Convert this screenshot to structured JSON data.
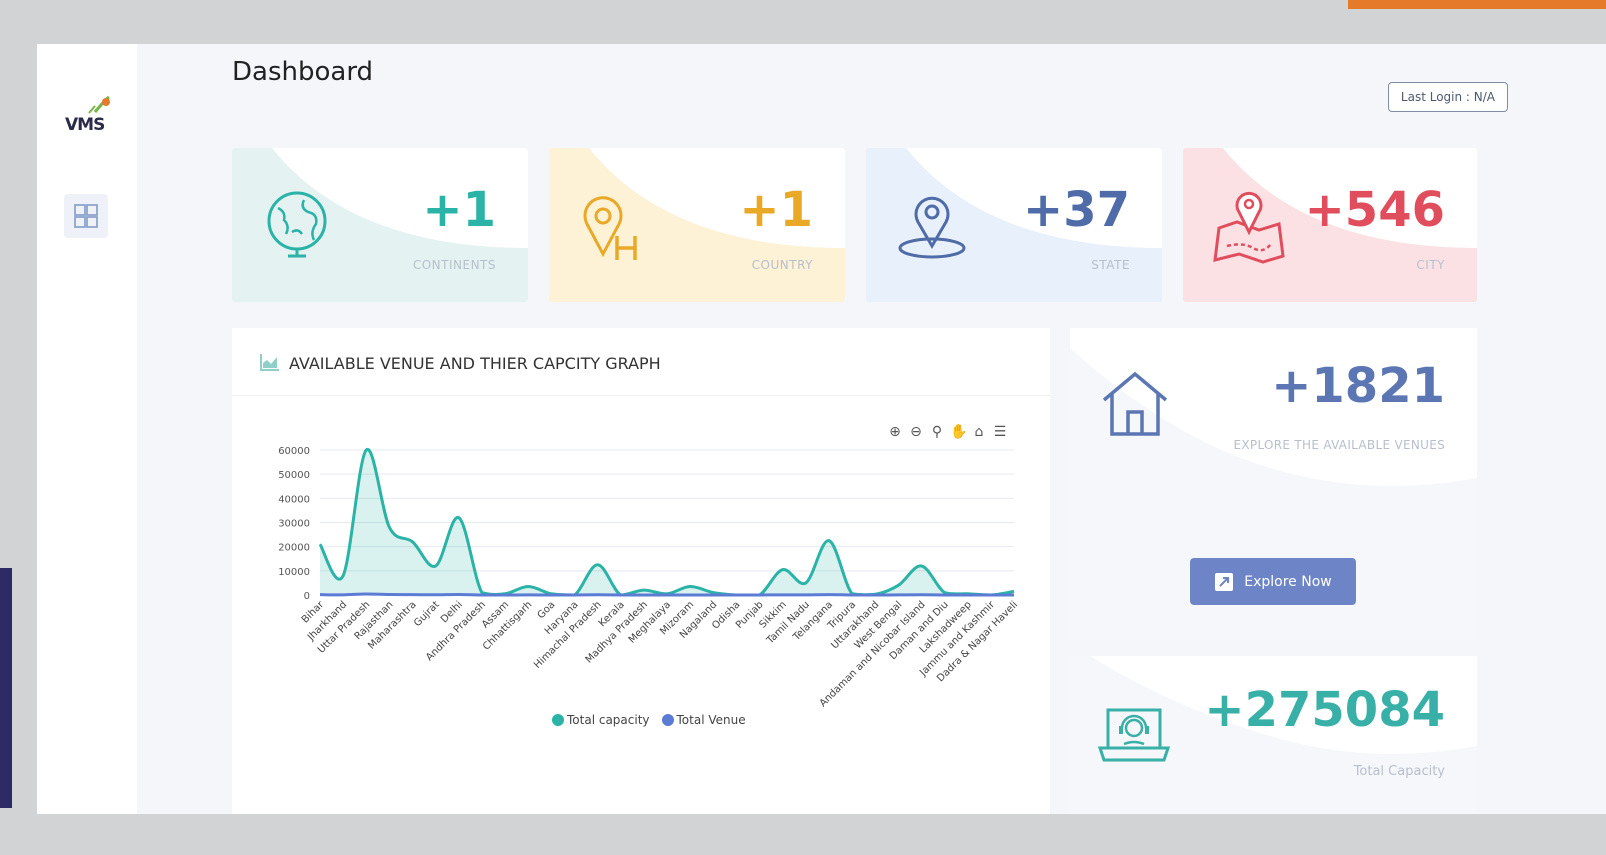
{
  "app": {
    "logo_text": "VMS"
  },
  "page": {
    "title": "Dashboard",
    "last_login": "Last Login : N/A"
  },
  "stats": [
    {
      "value": "+1",
      "label": "CONTINENTS",
      "icon": "globe-icon",
      "color": "#2ab3a6",
      "bg": "#e4f3f2"
    },
    {
      "value": "+1",
      "label": "COUNTRY",
      "icon": "country-pin-icon",
      "color": "#e9a927",
      "bg": "#fdf1d6"
    },
    {
      "value": "+37",
      "label": "STATE",
      "icon": "location-pin-icon",
      "color": "#4f6ba8",
      "bg": "#e8f0fb"
    },
    {
      "value": "+546",
      "label": "CITY",
      "icon": "map-route-icon",
      "color": "#e04e5e",
      "bg": "#fbe1e3"
    }
  ],
  "chart_card": {
    "title": "AVAILABLE VENUE AND THIER CAPCITY GRAPH"
  },
  "venues": {
    "value": "+1821",
    "label": "EXPLORE THE AVAILABLE VENUES",
    "button": "Explore Now",
    "icon": "house-icon"
  },
  "capacity": {
    "value": "+275084",
    "label": "Total Capacity",
    "icon": "support-laptop-icon"
  },
  "toolbar": [
    "zoom-in-icon",
    "zoom-out-icon",
    "magnify-icon",
    "pan-hand-icon",
    "home-icon",
    "menu-icon"
  ],
  "chart_data": {
    "type": "area",
    "title": "",
    "categories": [
      "Bihar",
      "Jharkhand",
      "Uttar Pradesh",
      "Rajasthan",
      "Maharashtra",
      "Gujrat",
      "Delhi",
      "Andhra Pradesh",
      "Assam",
      "Chhattisgarh",
      "Goa",
      "Haryana",
      "Himachal Pradesh",
      "Kerala",
      "Madhya Pradesh",
      "Meghalaya",
      "Mizoram",
      "Nagaland",
      "Odisha",
      "Punjab",
      "Sikkim",
      "Tamil Nadu",
      "Telangana",
      "Tripura",
      "Uttarakhand",
      "West Bengal",
      "Andaman and Nicobar Island",
      "Daman and Diu",
      "Lakshadweep",
      "Jammu and Kashmir",
      "Dadra & Nagar Haveli"
    ],
    "series": [
      {
        "name": "Total capacity",
        "color": "#2ab3a6",
        "values": [
          21000,
          8000,
          60000,
          28000,
          22000,
          12000,
          32000,
          1000,
          500,
          3500,
          500,
          0,
          12500,
          0,
          2000,
          500,
          3500,
          1000,
          0,
          0,
          10500,
          5000,
          22500,
          500,
          300,
          4000,
          12000,
          1000,
          500,
          0,
          1500
        ]
      },
      {
        "name": "Total Venue",
        "color": "#5b7bd5",
        "values": [
          150,
          60,
          420,
          200,
          150,
          90,
          220,
          10,
          5,
          30,
          5,
          0,
          90,
          0,
          15,
          5,
          25,
          10,
          0,
          0,
          75,
          35,
          160,
          5,
          3,
          30,
          85,
          10,
          5,
          0,
          12
        ]
      }
    ],
    "ylim": [
      0,
      60000
    ],
    "yticks": [
      "60000",
      "50000",
      "40000",
      "30000",
      "20000",
      "10000",
      "0"
    ],
    "grid": true,
    "legend": "bottom-center"
  }
}
